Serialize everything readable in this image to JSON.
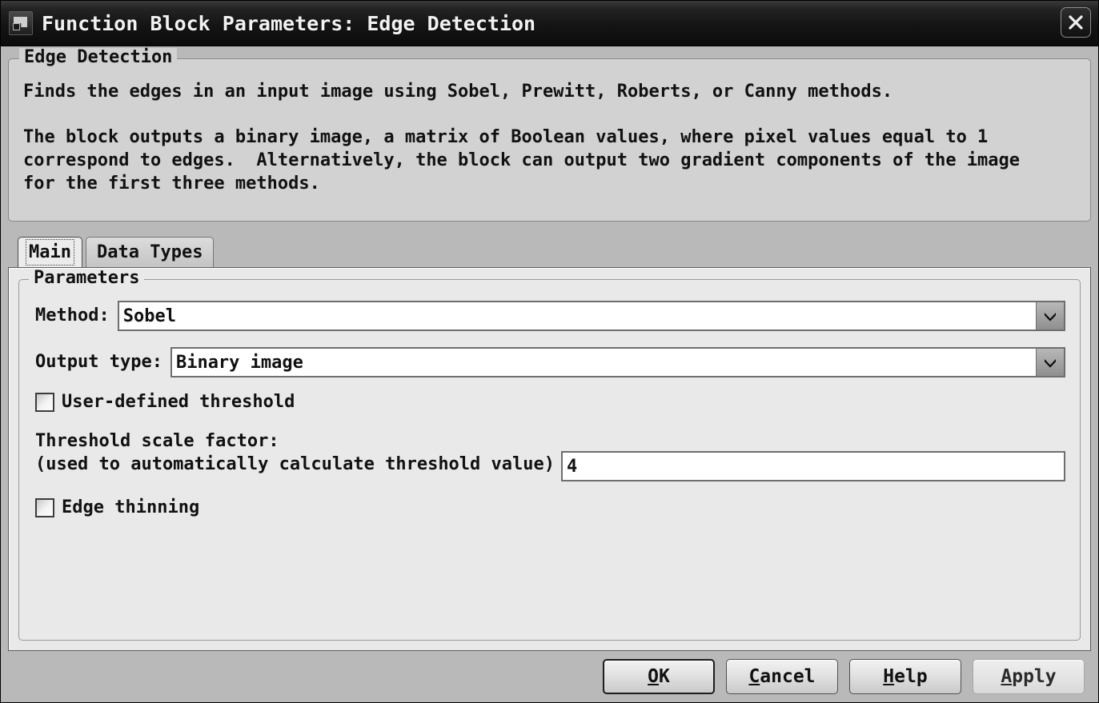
{
  "window": {
    "title": "Function Block Parameters: Edge Detection",
    "icon": "simulink-block-icon",
    "close_icon": "close-icon"
  },
  "description_group": {
    "title": "Edge Detection",
    "paragraph_1": "Finds the edges in an input image using Sobel, Prewitt, Roberts, or Canny methods.",
    "paragraph_2": "The block outputs a binary image, a matrix of Boolean values, where pixel values equal to 1\ncorrespond to edges.  Alternatively, the block can output two gradient components of the image\nfor the first three methods."
  },
  "tabs": [
    {
      "label": "Main",
      "selected": true
    },
    {
      "label": "Data Types",
      "selected": false
    }
  ],
  "parameters_group": {
    "title": "Parameters",
    "method": {
      "label": "Method:",
      "value": "Sobel",
      "arrow_icon": "chevron-down-icon"
    },
    "output_type": {
      "label": "Output type:",
      "value": "Binary image",
      "arrow_icon": "chevron-down-icon"
    },
    "user_defined_threshold": {
      "label": "User-defined threshold",
      "checked": false
    },
    "threshold_scale_factor": {
      "label": "Threshold scale factor:\n(used to automatically calculate threshold value)",
      "value": "4",
      "placeholder": ""
    },
    "edge_thinning": {
      "label": "Edge thinning",
      "checked": false
    }
  },
  "buttons": [
    {
      "name": "ok",
      "mnemonic": "O",
      "rest": "K",
      "default": true,
      "disabled": false
    },
    {
      "name": "cancel",
      "mnemonic": "C",
      "rest": "ancel",
      "default": false,
      "disabled": false
    },
    {
      "name": "help",
      "mnemonic": "H",
      "rest": "elp",
      "default": false,
      "disabled": false
    },
    {
      "name": "apply",
      "mnemonic": "A",
      "rest": "pply",
      "default": false,
      "disabled": true
    }
  ],
  "colors": {
    "titlebar": "#141414",
    "window_background": "#b9b9b9",
    "panel_background": "#e9e9e9",
    "group_background": "#d2d2d2",
    "field_background": "#ffffff",
    "text": "#111111"
  }
}
